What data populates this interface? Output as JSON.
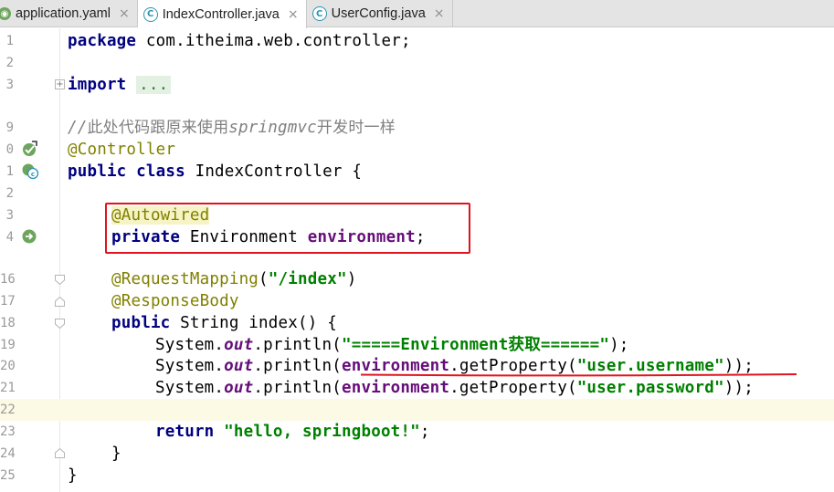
{
  "tabs": [
    {
      "label": "application.yaml",
      "icon": "yaml-file-icon",
      "active": false
    },
    {
      "label": "IndexController.java",
      "icon": "java-class-icon",
      "active": true
    },
    {
      "label": "UserConfig.java",
      "icon": "java-class-icon",
      "active": false
    }
  ],
  "tab_close_glyph": "×",
  "line_numbers": [
    "1",
    "2",
    "3",
    "",
    "9",
    "0",
    "1",
    "2",
    "3",
    "4",
    "",
    "16",
    "17",
    "18",
    "19",
    "20",
    "21",
    "22",
    "23",
    "24",
    "25"
  ],
  "code": {
    "l1_kw": "package",
    "l1_rest": " com.itheima.web.controller;",
    "l3_kw": "import",
    "l3_fold": "...",
    "l9_comment_a": "//",
    "l9_comment_cjk1": "此处代码跟原来使用",
    "l9_comment_b": "springmvc",
    "l9_comment_cjk2": "开发时一样",
    "l10_ann": "@Controller",
    "l11_kw": "public class",
    "l11_rest": " IndexController {",
    "l13_ann": "@Autowired",
    "l14_kw": "private",
    "l14_type": " Environment ",
    "l14_field": "environment",
    "l14_end": ";",
    "l16_ann": "@RequestMapping",
    "l16_open": "(",
    "l16_str": "\"/index\"",
    "l16_close": ")",
    "l17_ann": "@ResponseBody",
    "l18_kw": "public",
    "l18_rest": " String index() {",
    "l19_a": "System.",
    "l19_out": "out",
    "l19_b": ".println(",
    "l19_str": "\"=====Environment获取======\"",
    "l19_c": ");",
    "l20_a": "System.",
    "l20_out": "out",
    "l20_b": ".println(",
    "l20_field": "environment",
    "l20_c": ".getProperty(",
    "l20_str": "\"user.username\"",
    "l20_d": "));",
    "l21_a": "System.",
    "l21_out": "out",
    "l21_b": ".println(",
    "l21_field": "environment",
    "l21_c": ".getProperty(",
    "l21_str": "\"user.password\"",
    "l21_d": "));",
    "l23_kw": "return",
    "l23_sp": " ",
    "l23_str": "\"hello, springboot!\"",
    "l23_end": ";",
    "l24_brace": "}",
    "l25_brace": "}"
  },
  "colors": {
    "keyword": "#000080",
    "annotation": "#808000",
    "string": "#008000",
    "field": "#660e7a",
    "comment": "#808080",
    "highlight_box": "#e0141e",
    "current_line": "#fcfae4"
  }
}
